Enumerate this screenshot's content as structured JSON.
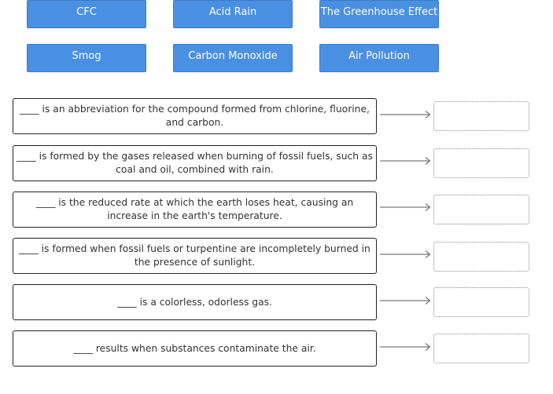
{
  "answer_tiles": [
    {
      "label": "CFC"
    },
    {
      "label": "Acid Rain"
    },
    {
      "label": "The Greenhouse Effect"
    },
    {
      "label": "Smog"
    },
    {
      "label": "Carbon Monoxide"
    },
    {
      "label": "Air Pollution"
    }
  ],
  "prompts": [
    {
      "text": "____ is an abbreviation for the compound formed from chlorine, fluorine, and carbon.",
      "answer": ""
    },
    {
      "text": "____ is formed by the gases released when burning of fossil fuels, such as coal and oil, combined with rain.",
      "answer": ""
    },
    {
      "text": "____ is the reduced rate at which the earth loses heat, causing an increase in the earth's temperature.",
      "answer": ""
    },
    {
      "text": "____ is formed when fossil fuels or turpentine are incompletely burned in the presence of sunlight.",
      "answer": ""
    },
    {
      "text": "____ is a colorless, odorless gas.",
      "answer": ""
    },
    {
      "text": "____ results when substances contaminate the air.",
      "answer": ""
    }
  ],
  "icons": {
    "arrow": "arrow-right-icon"
  },
  "colors": {
    "tile_background": "#4a90e2",
    "tile_text": "#ffffff",
    "prompt_border": "#222222"
  }
}
